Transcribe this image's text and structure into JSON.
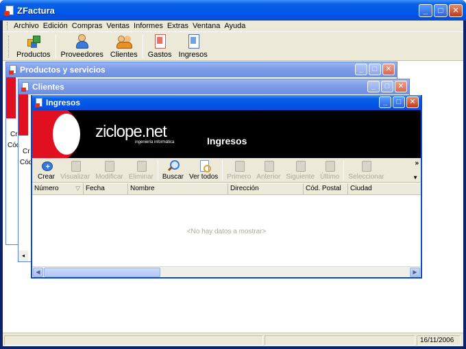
{
  "app": {
    "title": "ZFactura"
  },
  "menu": [
    "Archivo",
    "Edición",
    "Compras",
    "Ventas",
    "Informes",
    "Extras",
    "Ventana",
    "Ayuda"
  ],
  "toolbar": [
    {
      "label": "Productos",
      "icon": "products-icon"
    },
    {
      "label": "Proveedores",
      "icon": "suppliers-icon"
    },
    {
      "label": "Clientes",
      "icon": "clients-icon"
    },
    {
      "label": "Gastos",
      "icon": "expenses-icon"
    },
    {
      "label": "Ingresos",
      "icon": "income-icon"
    }
  ],
  "windows": {
    "productos": {
      "title": "Productos y servicios",
      "partial_labels": [
        "Cr",
        "Cód"
      ]
    },
    "clientes": {
      "title": "Clientes",
      "partial_labels": [
        "Cr",
        "Cód"
      ]
    },
    "ingresos": {
      "title": "Ingresos",
      "banner": {
        "logo": "ziclope.net",
        "logo_sub": "ingeniería informática",
        "title": "Ingresos"
      },
      "toolbar": [
        {
          "label": "Crear",
          "enabled": true,
          "icon": "create-icon"
        },
        {
          "label": "Visualizar",
          "enabled": false,
          "icon": "view-icon"
        },
        {
          "label": "Modificar",
          "enabled": false,
          "icon": "edit-icon"
        },
        {
          "label": "Eliminar",
          "enabled": false,
          "icon": "delete-icon"
        },
        {
          "label": "Buscar",
          "enabled": true,
          "icon": "search-icon"
        },
        {
          "label": "Ver todos",
          "enabled": true,
          "icon": "view-all-icon"
        },
        {
          "label": "Primero",
          "enabled": false,
          "icon": "first-icon"
        },
        {
          "label": "Anterior",
          "enabled": false,
          "icon": "previous-icon"
        },
        {
          "label": "Siguiente",
          "enabled": false,
          "icon": "next-icon"
        },
        {
          "label": "Último",
          "enabled": false,
          "icon": "last-icon"
        },
        {
          "label": "Seleccionar",
          "enabled": false,
          "icon": "select-icon"
        }
      ],
      "columns": [
        "Número",
        "Fecha",
        "Nombre",
        "Dirección",
        "Cód. Postal",
        "Ciudad"
      ],
      "empty_text": "<No hay datos a mostrar>"
    }
  },
  "status": {
    "date": "16/11/2006"
  },
  "colors": {
    "titlebar": "#0054e8",
    "banner_bg": "#000000",
    "banner_accent": "#e01020"
  }
}
